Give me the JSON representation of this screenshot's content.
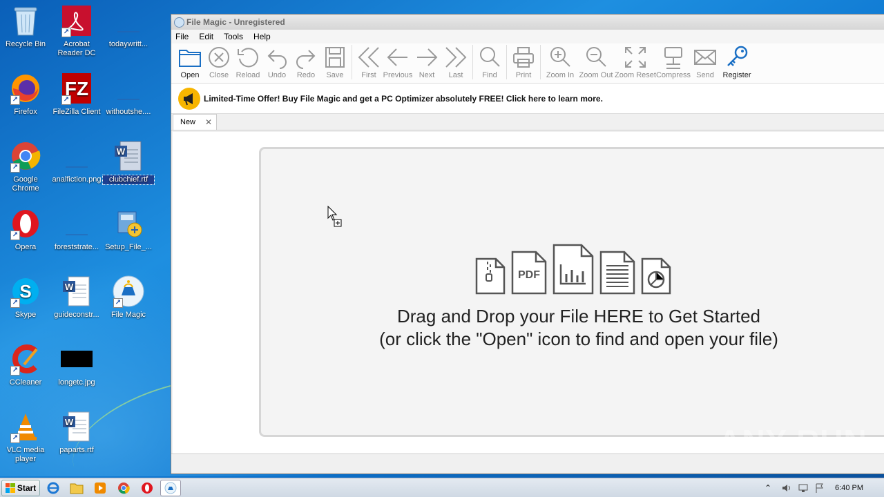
{
  "desktop": {
    "icons": [
      {
        "label": "Recycle Bin"
      },
      {
        "label": "Acrobat Reader DC"
      },
      {
        "label": "todaywritt..."
      },
      {
        "label": "Firefox"
      },
      {
        "label": "FileZilla Client"
      },
      {
        "label": "withoutshe...."
      },
      {
        "label": "Google Chrome"
      },
      {
        "label": "analfiction.png"
      },
      {
        "label": "clubchief.rtf"
      },
      {
        "label": "Opera"
      },
      {
        "label": "foreststrate..."
      },
      {
        "label": "Setup_File_..."
      },
      {
        "label": "Skype"
      },
      {
        "label": "guideconstr..."
      },
      {
        "label": "File Magic"
      },
      {
        "label": "CCleaner"
      },
      {
        "label": "longetc.jpg"
      },
      {
        "label": "VLC media player"
      },
      {
        "label": "paparts.rtf"
      }
    ]
  },
  "window": {
    "title": "File Magic - Unregistered",
    "menu": [
      "File",
      "Edit",
      "Tools",
      "Help"
    ],
    "toolbar": [
      {
        "label": "Open"
      },
      {
        "label": "Close"
      },
      {
        "label": "Reload"
      },
      {
        "label": "Undo"
      },
      {
        "label": "Redo"
      },
      {
        "label": "Save"
      },
      {
        "label": "First"
      },
      {
        "label": "Previous"
      },
      {
        "label": "Next"
      },
      {
        "label": "Last"
      },
      {
        "label": "Find"
      },
      {
        "label": "Print"
      },
      {
        "label": "Zoom In"
      },
      {
        "label": "Zoom Out"
      },
      {
        "label": "Zoom Reset"
      },
      {
        "label": "Compress"
      },
      {
        "label": "Send"
      },
      {
        "label": "Register"
      }
    ],
    "promo_text": "Limited-Time Offer! Buy File Magic and get a PC Optimizer absolutely FREE!  Click here to learn more.",
    "tab_label": "New",
    "drop_line1": "Drag and Drop your File HERE to Get Started",
    "drop_line2": "(or click the \"Open\" icon to find and open your file)",
    "pdf_icon_text": "PDF"
  },
  "taskbar": {
    "start_label": "Start",
    "clock": "6:40 PM"
  },
  "watermark": "ANY RUN",
  "colors": {
    "accent": "#1a6fc4",
    "icon_gray": "#8a8a8a",
    "promo_badge": "#f7b500"
  }
}
